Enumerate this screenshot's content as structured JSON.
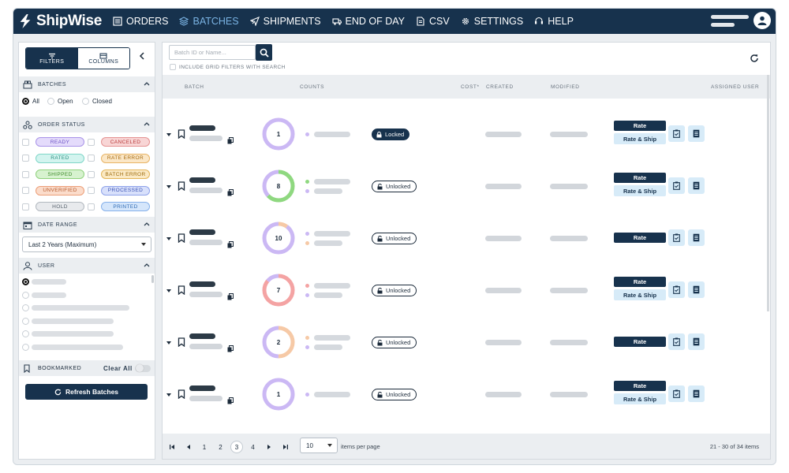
{
  "app": {
    "name": "ShipWise"
  },
  "nav": [
    {
      "label": "ORDERS",
      "icon": "list-icon",
      "active": false
    },
    {
      "label": "BATCHES",
      "icon": "stack-icon",
      "active": true
    },
    {
      "label": "SHIPMENTS",
      "icon": "plane-icon",
      "active": false
    },
    {
      "label": "END OF DAY",
      "icon": "truck-icon",
      "active": false
    },
    {
      "label": "CSV",
      "icon": "file-icon",
      "active": false
    },
    {
      "label": "SETTINGS",
      "icon": "gear-icon",
      "active": false
    },
    {
      "label": "HELP",
      "icon": "headset-icon",
      "active": false
    }
  ],
  "sidebar": {
    "filters_label": "FILTERS",
    "columns_label": "COLUMNS",
    "batches_title": "BATCHES",
    "batch_options": [
      {
        "label": "All",
        "selected": true
      },
      {
        "label": "Open",
        "selected": false
      },
      {
        "label": "Closed",
        "selected": false
      }
    ],
    "order_status_title": "ORDER STATUS",
    "statuses": [
      {
        "label": "READY",
        "bg": "#e4dbfb",
        "border": "#a994e8",
        "color": "#6a4fc4"
      },
      {
        "label": "CANCELED",
        "bg": "#f8d5d5",
        "border": "#e49393",
        "color": "#b83a3a"
      },
      {
        "label": "RATED",
        "bg": "#d3f4ef",
        "border": "#7fd6c8",
        "color": "#2a8f80"
      },
      {
        "label": "RATE ERROR",
        "bg": "#fbe7c7",
        "border": "#e8b466",
        "color": "#a66a10"
      },
      {
        "label": "SHIPPED",
        "bg": "#d7f2cf",
        "border": "#8fd17c",
        "color": "#3c8a28"
      },
      {
        "label": "BATCH ERROR",
        "bg": "#fbe9c3",
        "border": "#e3b55a",
        "color": "#9c6a0c"
      },
      {
        "label": "UNVERIFIED",
        "bg": "#fbdccb",
        "border": "#ec9e78",
        "color": "#b4572a"
      },
      {
        "label": "PROCESSED",
        "bg": "#d8e0fb",
        "border": "#8fa3ea",
        "color": "#3a52b4"
      },
      {
        "label": "HOLD",
        "bg": "#e8eaed",
        "border": "#b2b8bf",
        "color": "#55606b"
      },
      {
        "label": "PRINTED",
        "bg": "#d5e6fb",
        "border": "#86b1ea",
        "color": "#2e6ab4"
      }
    ],
    "date_range_title": "DATE RANGE",
    "date_range_value": "Last 2 Years (Maximum)",
    "user_title": "USER",
    "bookmarked_title": "BOOKMARKED",
    "clear_all": "Clear All",
    "refresh_label": "Refresh Batches"
  },
  "main": {
    "search_placeholder": "Batch ID or Name...",
    "include_label": "INCLUDE GRID FILTERS WITH SEARCH",
    "columns": [
      "BATCH",
      "COUNTS",
      "COST*",
      "CREATED",
      "MODIFIED",
      "ASSIGNED USER"
    ],
    "rows": [
      {
        "count": "1",
        "lock": "Locked",
        "locked": true,
        "segments": [
          {
            "color": "#cbb8f4",
            "frac": 1
          }
        ],
        "dots": [
          "#cbb8f4"
        ],
        "rate": "Rate",
        "rate_ship": "Rate & Ship"
      },
      {
        "count": "8",
        "lock": "Unlocked",
        "locked": false,
        "segments": [
          {
            "color": "#8fd880",
            "frac": 0.63
          },
          {
            "color": "#cbb8f4",
            "frac": 0.37
          }
        ],
        "dots": [
          "#8fd880",
          "#cbb8f4"
        ],
        "rate": "Rate",
        "rate_ship": "Rate & Ship"
      },
      {
        "count": "10",
        "lock": "Unlocked",
        "locked": false,
        "segments": [
          {
            "color": "#f6c9a6",
            "frac": 0.1
          },
          {
            "color": "#cbb8f4",
            "frac": 0.9
          }
        ],
        "dots": [
          "#cbb8f4",
          "#f6c9a6"
        ],
        "rate": "Rate",
        "rate_ship": ""
      },
      {
        "count": "7",
        "lock": "Unlocked",
        "locked": false,
        "segments": [
          {
            "color": "#f4a3a3",
            "frac": 0.86
          },
          {
            "color": "#cbb8f4",
            "frac": 0.14
          }
        ],
        "dots": [
          "#f4a3a3",
          "#cbb8f4"
        ],
        "rate": "Rate",
        "rate_ship": "Rate & Ship"
      },
      {
        "count": "2",
        "lock": "Unlocked",
        "locked": false,
        "segments": [
          {
            "color": "#f6c9a6",
            "frac": 0.5
          },
          {
            "color": "#cbb8f4",
            "frac": 0.5
          }
        ],
        "dots": [
          "#f6c9a6",
          "#cbb8f4"
        ],
        "rate": "Rate",
        "rate_ship": ""
      },
      {
        "count": "1",
        "lock": "Unlocked",
        "locked": false,
        "segments": [
          {
            "color": "#cbb8f4",
            "frac": 1
          }
        ],
        "dots": [
          "#cbb8f4"
        ],
        "rate": "Rate",
        "rate_ship": "Rate & Ship"
      }
    ]
  },
  "pager": {
    "pages": [
      "1",
      "2",
      "3",
      "4"
    ],
    "current": "3",
    "per_page": "10",
    "per_page_label": "items per page",
    "summary": "21 - 30 of 34 items"
  }
}
